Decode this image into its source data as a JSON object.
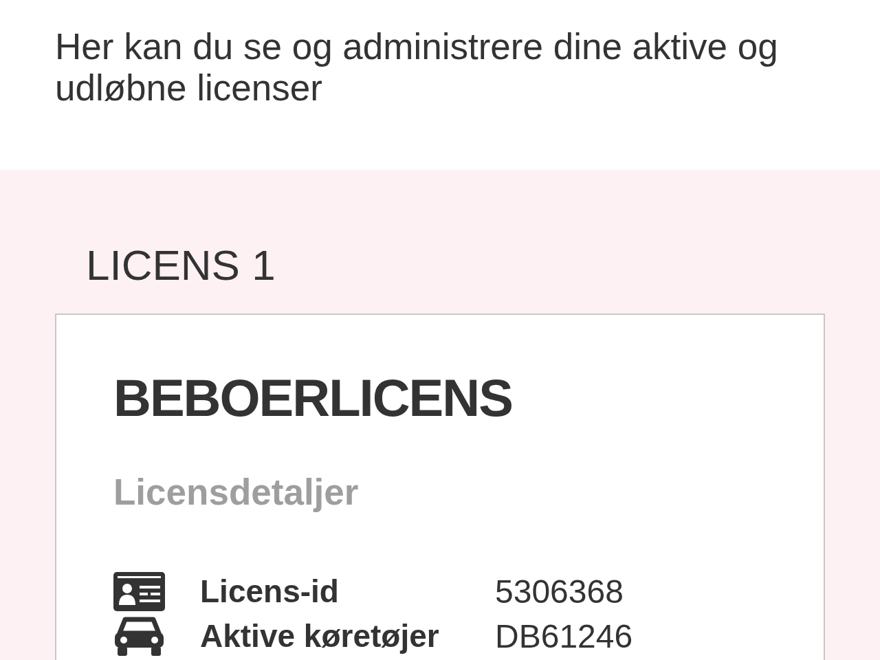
{
  "intro": {
    "text": "Her kan du se og administrere dine aktive og udløbne licenser"
  },
  "licenses": [
    {
      "heading": "LICENS 1",
      "type": "BEBOERLICENS",
      "details_title": "Licensdetaljer",
      "details": [
        {
          "kind": "id",
          "label": "Licens-id",
          "value": "5306368"
        },
        {
          "kind": "vehicle",
          "label": "Aktive køretøjer",
          "value": "DB61246"
        }
      ]
    }
  ]
}
